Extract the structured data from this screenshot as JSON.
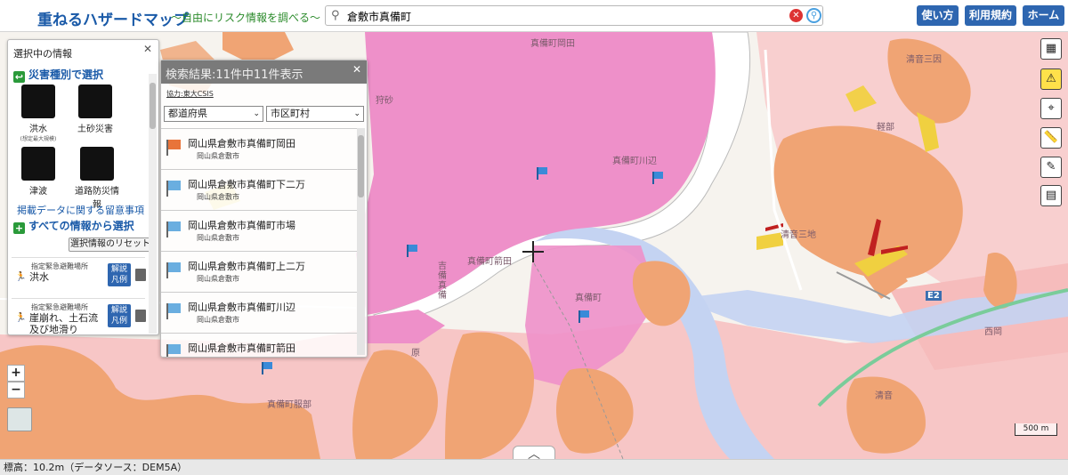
{
  "header": {
    "title": "重ねるハザードマップ",
    "subtitle": "〜自由にリスク情報を調べる〜",
    "search_value": "倉敷市真備町",
    "buttons": [
      "使い方",
      "利用規約",
      "ホーム"
    ]
  },
  "info_panel": {
    "title": "選択中の情報",
    "by_type": "災害種別で選択",
    "hazards": [
      {
        "label": "洪水",
        "note": "(想定最大規模)",
        "icon": "flood-icon"
      },
      {
        "label": "土砂災害",
        "icon": "landslide-icon"
      },
      {
        "label": "津波",
        "icon": "tsunami-icon"
      },
      {
        "label": "道路防災情報",
        "icon": "road-disaster-icon"
      }
    ],
    "notice": "掲載データに関する留意事項",
    "all_info": "すべての情報から選択",
    "reset": "選択情報のリセット",
    "selected": [
      {
        "category": "指定緊急避難場所",
        "name": "洪水",
        "legend": "解説 凡例"
      },
      {
        "category": "指定緊急避難場所",
        "name": "崖崩れ、土石流及び地滑り",
        "legend": "解説 凡例"
      }
    ]
  },
  "results": {
    "title": "検索結果:11件中11件表示",
    "credit": "協力:東大CSIS",
    "filter_pref": "都道府県",
    "filter_city": "市区町村",
    "items": [
      {
        "name": "岡山県倉敷市真備町岡田",
        "sub": "岡山県倉敷市",
        "flag": "orange"
      },
      {
        "name": "岡山県倉敷市真備町下二万",
        "sub": "岡山県倉敷市",
        "flag": "blue"
      },
      {
        "name": "岡山県倉敷市真備町市場",
        "sub": "岡山県倉敷市",
        "flag": "blue"
      },
      {
        "name": "岡山県倉敷市真備町上二万",
        "sub": "岡山県倉敷市",
        "flag": "blue"
      },
      {
        "name": "岡山県倉敷市真備町川辺",
        "sub": "岡山県倉敷市",
        "flag": "blue"
      },
      {
        "name": "岡山県倉敷市真備町箭田",
        "sub": "",
        "flag": "blue"
      }
    ]
  },
  "map": {
    "places": [
      "真備町岡田",
      "狩砂",
      "真備町川辺",
      "真備町箭田",
      "吉備真備",
      "真備町",
      "原",
      "真備町服部",
      "清音三因",
      "軽部",
      "清音三地",
      "西岡",
      "E2",
      "清音"
    ],
    "scale": "500 m",
    "zoom_in": "+",
    "zoom_out": "−"
  },
  "footer": {
    "elevation": "標高：10.2m（データソース：DEM5A）"
  },
  "colors": {
    "flood_pink": "#ee8ec8",
    "landslide_orange": "#f0a070",
    "light_pink": "#f7c3c3",
    "river": "#bcd0f0",
    "accent": "#2e66b0"
  }
}
